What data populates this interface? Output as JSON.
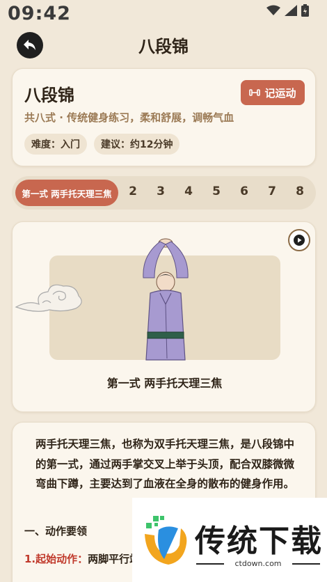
{
  "status_bar": {
    "time": "09:42"
  },
  "header": {
    "title": "八段锦",
    "back_icon": "back-arrow-icon"
  },
  "info": {
    "title": "八段锦",
    "record_button": "记运动",
    "subtitle": "共八式 · 传统健身练习，柔和舒展，调畅气血",
    "difficulty": "难度：入门",
    "suggestion": "建议：约12分钟"
  },
  "tabs": {
    "active": "第一式 两手托天理三焦",
    "numbers": [
      "2",
      "3",
      "4",
      "5",
      "6",
      "7",
      "8"
    ]
  },
  "figure": {
    "caption": "第一式 两手托天理三焦",
    "play_icon": "play-icon"
  },
  "content": {
    "paragraph": "两手托天理三焦，也称为双手托天理三焦，是八段锦中的第一式，通过两手掌交叉上举于头顶，配合双膝微微弯曲下蹲，主要达到了血液在全身的散布的健身作用。",
    "section_title": "一、动作要领",
    "step_label": "1.起始动作：",
    "step_text": "两脚平行站立，两臂分别自左右身侧向上高举"
  },
  "ad": {
    "title": "传统下载",
    "url": "ctdown.com"
  },
  "colors": {
    "accent": "#c8674f",
    "background": "#f1e8d9",
    "card": "#fbf6ed"
  }
}
